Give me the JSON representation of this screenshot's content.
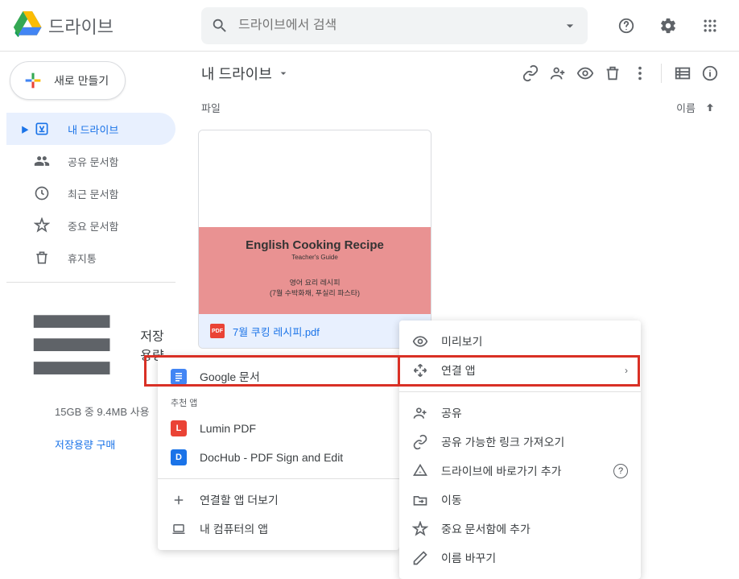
{
  "brand": "드라이브",
  "search": {
    "placeholder": "드라이브에서 검색"
  },
  "new_button": "새로 만들기",
  "sidebar": {
    "items": [
      {
        "label": "내 드라이브",
        "icon": "my-drive",
        "active": true,
        "caret": true
      },
      {
        "label": "공유 문서함",
        "icon": "shared",
        "active": false
      },
      {
        "label": "최근 문서함",
        "icon": "recent",
        "active": false
      },
      {
        "label": "중요 문서함",
        "icon": "starred",
        "active": false
      },
      {
        "label": "휴지통",
        "icon": "trash",
        "active": false
      }
    ],
    "storage_label": "저장용량",
    "storage_usage": "15GB 중 9.4MB 사용",
    "buy_storage": "저장용량 구매"
  },
  "breadcrumb": "내 드라이브",
  "section_label": "파일",
  "sort_label": "이름",
  "file": {
    "name": "7월 쿠킹 레시피.pdf",
    "thumb": {
      "title": "English Cooking Recipe",
      "subtitle": "Teacher's Guide",
      "kor1": "영어 요리 레시피",
      "kor2": "(7월 수박화채, 푸실리 파스타)"
    }
  },
  "submenu": {
    "heading": "추천 앱",
    "google_docs": "Google 문서",
    "lumin": "Lumin PDF",
    "dochub": "DocHub - PDF Sign and Edit",
    "connect_more": "연결할 앱 더보기",
    "my_computer": "내 컴퓨터의 앱"
  },
  "context": {
    "preview": "미리보기",
    "open_with": "연결 앱",
    "share": "공유",
    "get_link": "공유 가능한 링크 가져오기",
    "add_shortcut": "드라이브에 바로가기 추가",
    "move": "이동",
    "add_star": "중요 문서함에 추가",
    "rename": "이름 바꾸기"
  }
}
